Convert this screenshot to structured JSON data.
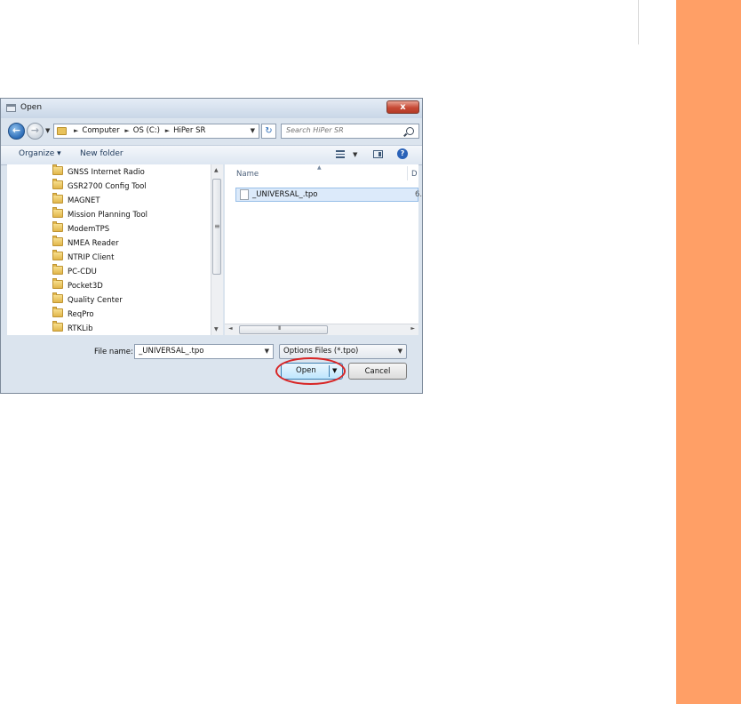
{
  "dialog": {
    "title": "Open",
    "close_glyph": "x"
  },
  "address": {
    "breadcrumbs": [
      "Computer",
      "OS (C:)",
      "HiPer SR"
    ],
    "search_placeholder": "Search HiPer SR"
  },
  "toolbar": {
    "organize_label": "Organize ▾",
    "new_folder_label": "New folder"
  },
  "nav": {
    "items": [
      "GNSS Internet Radio",
      "GSR2700 Config Tool",
      "MAGNET",
      "Mission Planning Tool",
      "ModemTPS",
      "NMEA Reader",
      "NTRIP Client",
      "PC-CDU",
      "Pocket3D",
      "Quality Center",
      "ReqPro",
      "RTKLib"
    ]
  },
  "files": {
    "column_name": "Name",
    "column_next": "D",
    "items": [
      {
        "name": "_UNIVERSAL_.tpo",
        "extra": "6."
      }
    ]
  },
  "bottom": {
    "file_name_label": "File name:",
    "file_name_value": "_UNIVERSAL_.tpo",
    "file_type": "Options Files (*.tpo)",
    "open_label": "Open",
    "cancel_label": "Cancel"
  },
  "colors": {
    "side_accent": "#ff9f66",
    "highlight": "#d82424"
  },
  "icons": [
    "back-arrow-icon",
    "forward-arrow-icon",
    "folder-icon",
    "refresh-icon",
    "search-icon",
    "views-icon",
    "preview-pane-icon",
    "help-icon",
    "file-icon"
  ]
}
